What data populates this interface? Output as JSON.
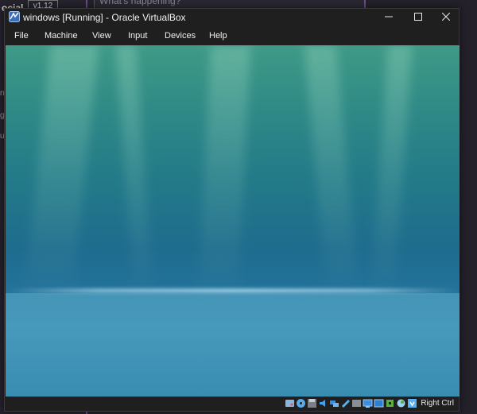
{
  "background": {
    "left_label": "ocial",
    "left_badge": "v1.12",
    "input_placeholder": "What's happening?",
    "edge_chars": [
      "n",
      "g",
      "u"
    ]
  },
  "window": {
    "title": "windows [Running] - Oracle VirtualBox",
    "controls": {
      "minimize": "minimize-icon",
      "maximize": "maximize-icon",
      "close": "close-icon"
    }
  },
  "menu": {
    "items": [
      "File",
      "Machine",
      "View",
      "Input",
      "Devices",
      "Help"
    ]
  },
  "statusbar": {
    "icons": [
      "hard-disk-icon",
      "optical-drive-icon",
      "floppy-icon",
      "audio-icon",
      "network-icon",
      "usb-icon",
      "shared-folders-icon",
      "display-icon",
      "video-capture-icon",
      "cpu-icon",
      "mouse-integration-icon",
      "keyboard-icon",
      "host-key-icon"
    ],
    "host_key": "Right Ctrl"
  },
  "colors": {
    "accent": "#6a4e8a",
    "window_bg": "#1f1f1f"
  }
}
